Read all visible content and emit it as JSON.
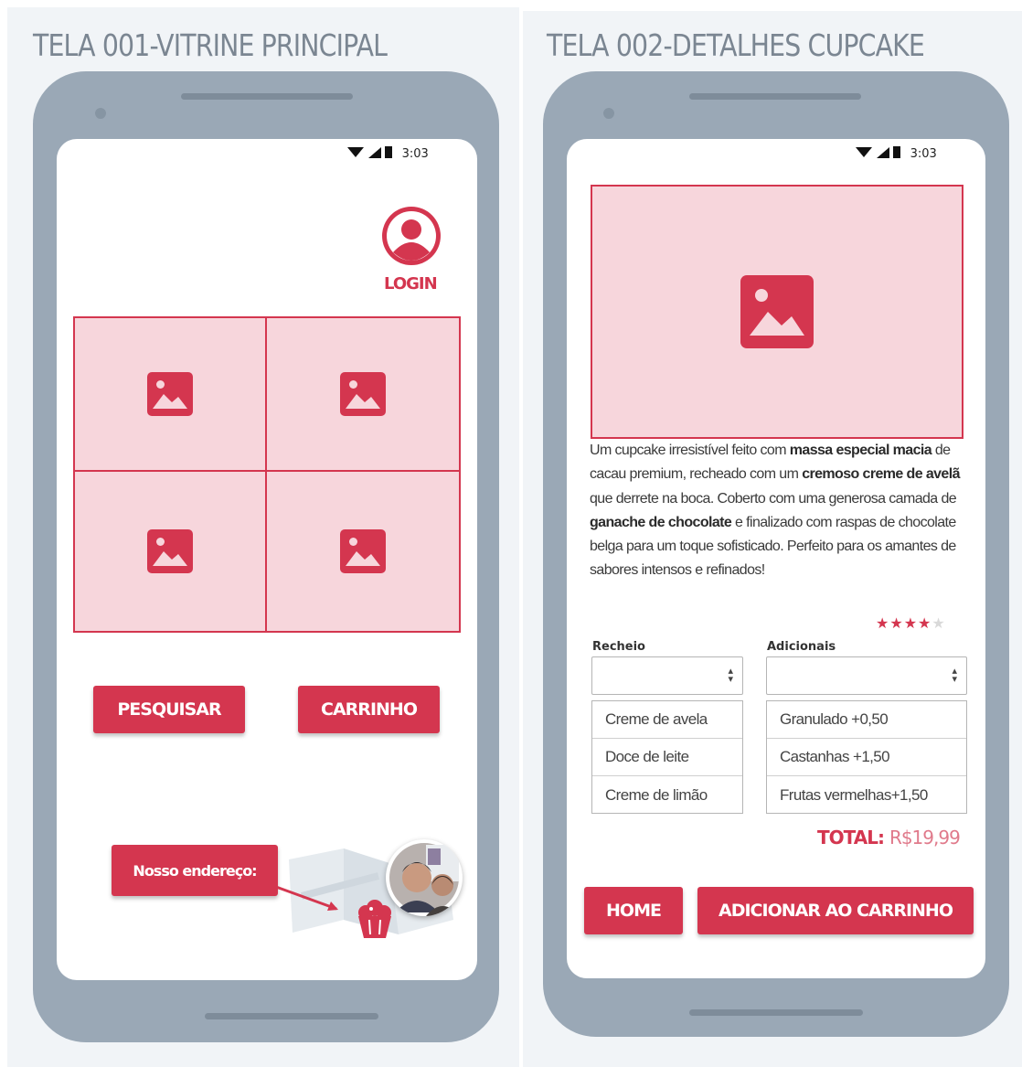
{
  "screen1": {
    "title": "TELA 001-VITRINE PRINCIPAL",
    "status_time": "3:03",
    "login_label": "LOGIN",
    "search_button": "PESQUISAR",
    "cart_button": "CARRINHO",
    "address_label": "Nosso endereço:"
  },
  "screen2": {
    "title": "TELA 002-DETALHES CUPCAKE",
    "status_time": "3:03",
    "description": [
      {
        "t": " Um cupcake irresistível feito com ",
        "b": false
      },
      {
        "t": "massa especial macia",
        "b": true
      },
      {
        "t": " de cacau premium, recheado com um ",
        "b": false
      },
      {
        "t": "cremoso creme de avelã",
        "b": true
      },
      {
        "t": " que derrete na boca. Coberto com uma generosa camada de ",
        "b": false
      },
      {
        "t": "ganache de chocolate",
        "b": true
      },
      {
        "t": " e finalizado com raspas de chocolate belga para um toque sofisticado. Perfeito para os amantes de sabores intensos e refinados!",
        "b": false
      }
    ],
    "rating": 4,
    "rating_max": 5,
    "filling_label": "Recheio",
    "extras_label": "Adicionais",
    "filling_options": [
      "Creme de avela",
      "Doce de leite",
      "Creme de limão"
    ],
    "extras_options": [
      "Granulado +0,50",
      "Castanhas +1,50",
      "Frutas vermelhas+1,50"
    ],
    "total_label": "TOTAL:",
    "total_value": "R$19,99",
    "home_button": "HOME",
    "add_to_cart_button": "ADICIONAR AO CARRINHO"
  },
  "colors": {
    "accent": "#d4364f",
    "image_placeholder": "#f7d6dc",
    "phone_body": "#9aa8b6",
    "title_gray": "#7b8692"
  },
  "icons": [
    "wifi-icon",
    "signal-icon",
    "battery-icon",
    "user-avatar-icon",
    "image-placeholder-icon",
    "map-icon",
    "cupcake-icon",
    "star-icon"
  ]
}
